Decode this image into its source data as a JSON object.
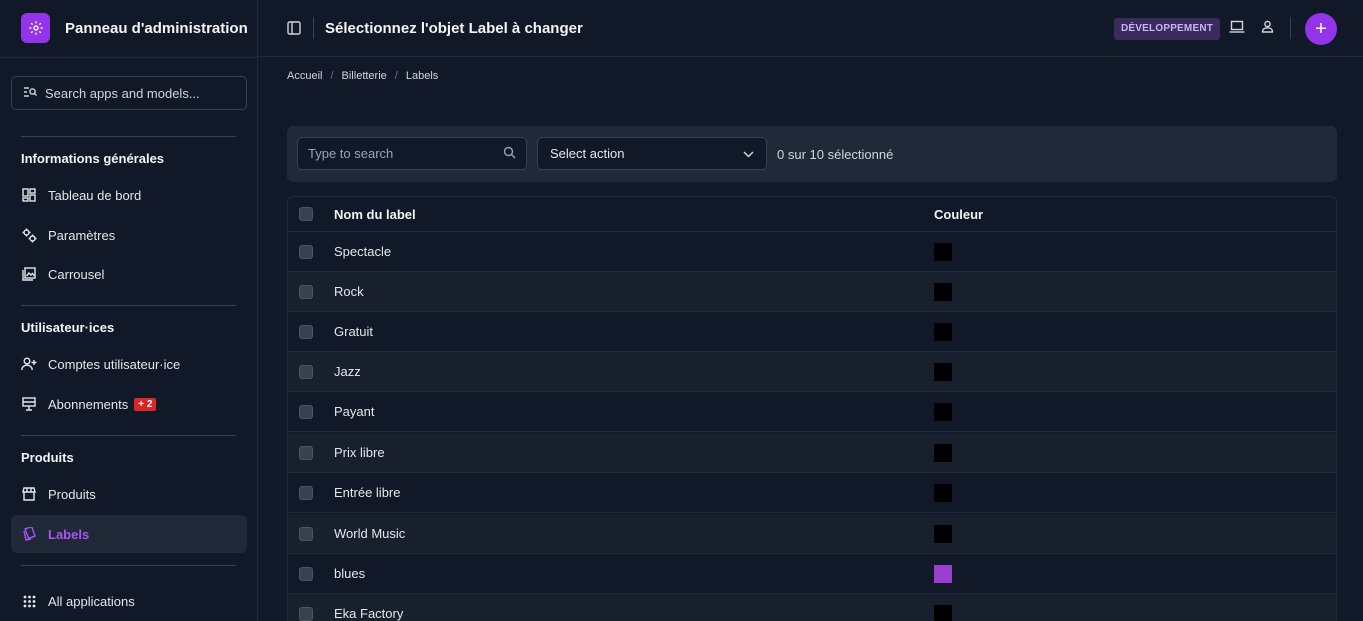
{
  "app": {
    "title": "Panneau d'administration"
  },
  "sidebar": {
    "search_placeholder": "Search apps and models...",
    "sections": [
      {
        "title": "Informations générales"
      },
      {
        "title": "Utilisateur·ices"
      },
      {
        "title": "Produits"
      }
    ],
    "items": [
      {
        "label": "Tableau de bord",
        "icon": "dashboard-icon"
      },
      {
        "label": "Paramètres",
        "icon": "settings-icon"
      },
      {
        "label": "Carrousel",
        "icon": "image-icon"
      },
      {
        "label": "Comptes utilisateur·ice",
        "icon": "person-add-icon"
      },
      {
        "label": "Abonnements",
        "icon": "subscriptions-icon",
        "badge": "+ 2"
      },
      {
        "label": "Produits",
        "icon": "store-icon"
      },
      {
        "label": "Labels",
        "icon": "label-icon",
        "active": true
      }
    ],
    "footer": {
      "label": "All applications",
      "icon": "apps-grid-icon"
    }
  },
  "header": {
    "title": "Sélectionnez l'objet Label à changer",
    "env_badge": "DÉVELOPPEMENT"
  },
  "breadcrumb": [
    "Accueil",
    "Billetterie",
    "Labels"
  ],
  "toolbar": {
    "search_placeholder": "Type to search",
    "action_select": "Select action",
    "selection_count": "0 sur 10 sélectionné"
  },
  "table": {
    "columns": [
      "Nom du label",
      "Couleur"
    ],
    "rows": [
      {
        "name": "Spectacle",
        "color": "#000000"
      },
      {
        "name": "Rock",
        "color": "#000000"
      },
      {
        "name": "Gratuit",
        "color": "#000000"
      },
      {
        "name": "Jazz",
        "color": "#000000"
      },
      {
        "name": "Payant",
        "color": "#000000"
      },
      {
        "name": "Prix libre",
        "color": "#000000"
      },
      {
        "name": "Entrée libre",
        "color": "#000000"
      },
      {
        "name": "World Music",
        "color": "#000000"
      },
      {
        "name": "blues",
        "color": "#9b3fd1"
      },
      {
        "name": "Eka Factory",
        "color": "#000000"
      }
    ]
  },
  "colors": {
    "accent": "#9333ea",
    "background": "#111827",
    "badge_red": "#dc2626"
  }
}
